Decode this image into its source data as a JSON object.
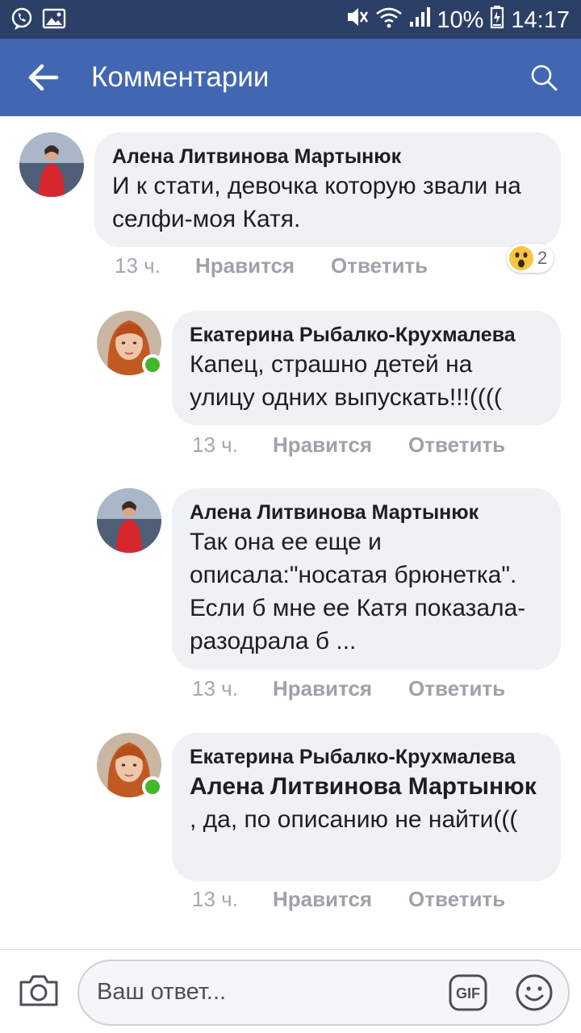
{
  "status_bar": {
    "battery_percent": "10%",
    "time": "14:17",
    "icons": [
      "viber-icon",
      "gallery-icon",
      "mute-icon",
      "wifi-icon",
      "signal-icon",
      "battery-icon"
    ]
  },
  "app_bar": {
    "title": "Комментарии",
    "back_icon": "arrow-left-icon",
    "search_icon": "search-icon"
  },
  "comments": [
    {
      "author": "Алена Литвинова Мартынюк",
      "text": "И к стати, девочка которую звали на селфи-моя Катя.",
      "time": "13 ч.",
      "like_label": "Нравится",
      "reply_label": "Ответить",
      "reaction": {
        "icon": "wow-emoji-icon",
        "count": "2"
      },
      "online": false
    },
    {
      "author": "Екатерина Рыбалко-Крухмалева",
      "text": "Капец, страшно детей на улицу одних выпускать!!!((((",
      "time": "13 ч.",
      "like_label": "Нравится",
      "reply_label": "Ответить",
      "online": true
    },
    {
      "author": "Алена Литвинова Мартынюк",
      "text": "Так она ее еще и описала:\"носатая брюнетка\". Если б мне ее Катя показала-разодрала б ...",
      "time": "13 ч.",
      "like_label": "Нравится",
      "reply_label": "Ответить",
      "online": false
    },
    {
      "author": "Екатерина Рыбалко-Крухмалева",
      "mention": "Алена Литвинова Мартынюк",
      "text": " , да, по описанию не найти(((",
      "time": "13 ч.",
      "like_label": "Нравится",
      "reply_label": "Ответить",
      "online": true
    }
  ],
  "reply_bar": {
    "placeholder": "Ваш ответ...",
    "camera_icon": "camera-icon",
    "gif_label": "GIF",
    "emoji_icon": "smiley-icon"
  },
  "colors": {
    "status_bar": "#2c3f66",
    "app_bar": "#4267b2",
    "bubble": "#f0f1f4",
    "online": "#42b72a"
  }
}
